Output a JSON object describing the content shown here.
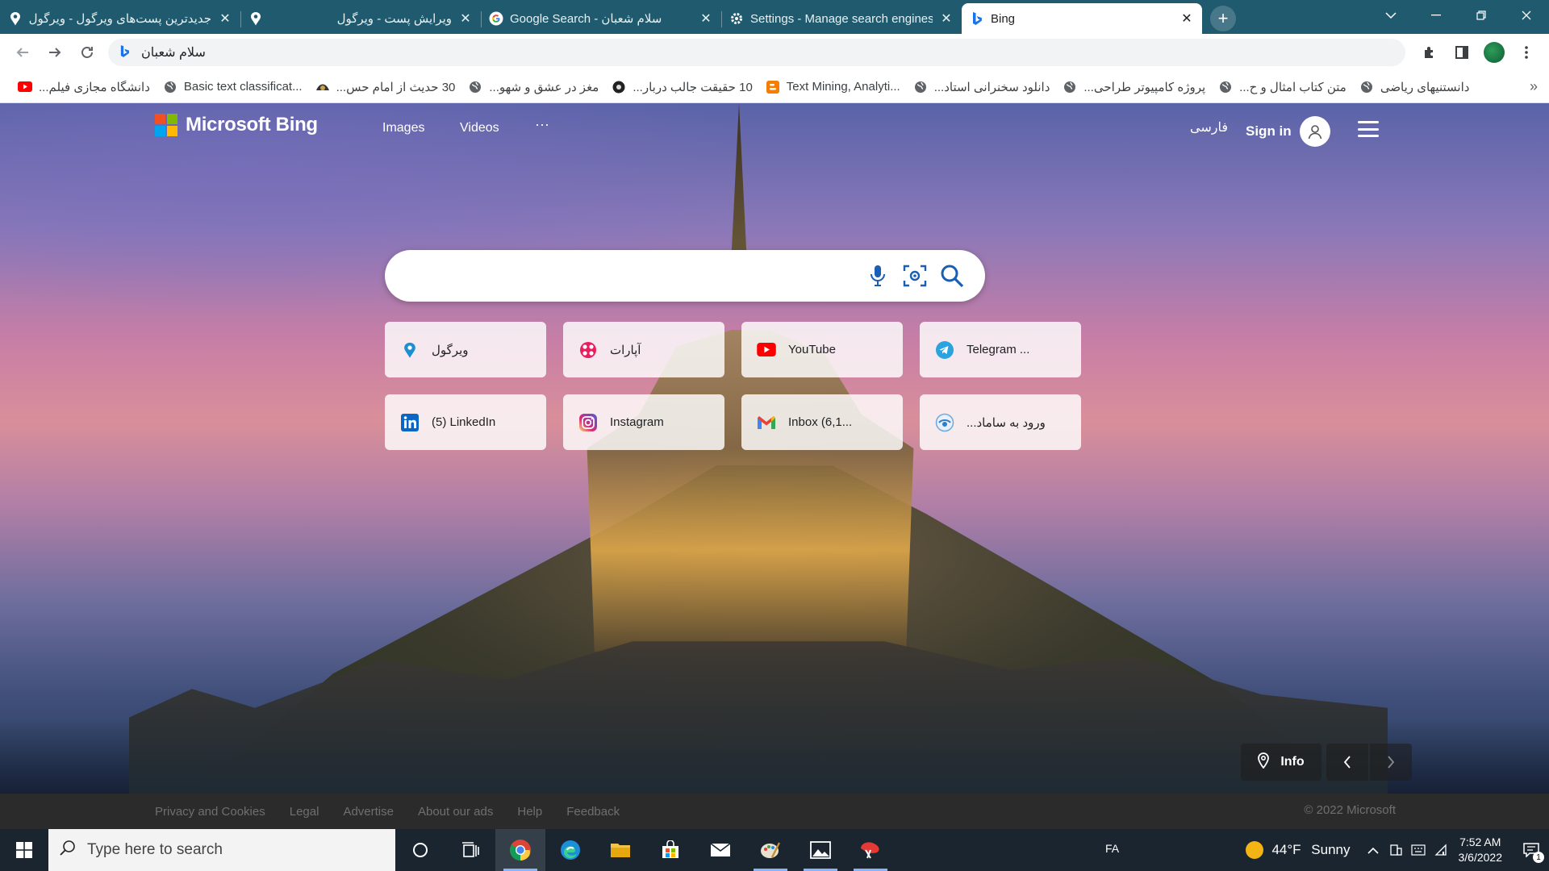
{
  "browser": {
    "tabs": [
      {
        "title": "جدیدترین پست‌های ویرگول - ویرگول",
        "icon": "virgool-icon",
        "rtl": true
      },
      {
        "title": "ویرایش پست - ویرگول",
        "icon": "virgool-icon",
        "rtl": true
      },
      {
        "title": "Google Search - سلام شعبان",
        "icon": "google-icon",
        "rtl": false
      },
      {
        "title": "Settings - Manage search engines",
        "icon": "settings-icon",
        "rtl": false
      },
      {
        "title": "Bing",
        "icon": "bing-icon",
        "rtl": false,
        "active": true
      }
    ],
    "address_bar": {
      "value": "سلام شعبان"
    },
    "bookmarks": [
      {
        "label": "دانشگاه مجازی فیلم...",
        "icon": "youtube-icon",
        "rtl": true
      },
      {
        "label": "Basic text classificat...",
        "icon": "globe-icon",
        "rtl": false
      },
      {
        "label": "30 حدیث از امام حس...",
        "icon": "site-icon",
        "rtl": true
      },
      {
        "label": "مغز در عشق و شهو...",
        "icon": "globe-icon",
        "rtl": true
      },
      {
        "label": "10 حقیقت جالب دربار...",
        "icon": "site-icon",
        "rtl": true
      },
      {
        "label": "Text Mining, Analyti...",
        "icon": "blogger-icon",
        "rtl": false
      },
      {
        "label": "دانلود سخنرانی استاد...",
        "icon": "globe-icon",
        "rtl": true
      },
      {
        "label": "پروژه کامپیوتر طراحی...",
        "icon": "globe-icon",
        "rtl": true
      },
      {
        "label": "متن کتاب امثال و ح...",
        "icon": "globe-icon",
        "rtl": true
      },
      {
        "label": "دانستنیهای ریاضی",
        "icon": "globe-icon",
        "rtl": true
      }
    ],
    "bookmarks_more": "»"
  },
  "bing": {
    "logo_text": "Microsoft Bing",
    "nav": [
      {
        "label": "Images"
      },
      {
        "label": "Videos"
      },
      {
        "label": "···"
      }
    ],
    "language_link": "فارسی",
    "sign_in": "Sign in",
    "search": {
      "value": "",
      "placeholder": ""
    },
    "quick_links": [
      {
        "label": "ویرگول",
        "icon": "virgool-icon",
        "rtl": true
      },
      {
        "label": "آپارات",
        "icon": "aparat-icon",
        "rtl": true
      },
      {
        "label": "YouTube",
        "icon": "youtube-icon",
        "rtl": false
      },
      {
        "label": "Telegram ...",
        "icon": "telegram-icon",
        "rtl": false
      },
      {
        "label": "(5) LinkedIn",
        "icon": "linkedin-icon",
        "rtl": false
      },
      {
        "label": "Instagram",
        "icon": "instagram-icon",
        "rtl": false
      },
      {
        "label": "Inbox (6,1...",
        "icon": "gmail-icon",
        "rtl": false
      },
      {
        "label": "ورود به ساماد...",
        "icon": "samad-icon",
        "rtl": true
      }
    ],
    "info_button": "Info",
    "footer": {
      "links": [
        {
          "label": "Privacy and Cookies"
        },
        {
          "label": "Legal"
        },
        {
          "label": "Advertise"
        },
        {
          "label": "About our ads"
        },
        {
          "label": "Help"
        },
        {
          "label": "Feedback"
        }
      ],
      "copyright": "© 2022 Microsoft"
    }
  },
  "taskbar": {
    "search_placeholder": "Type here to search",
    "apps": [
      {
        "icon": "cortana-icon"
      },
      {
        "icon": "task-view-icon"
      },
      {
        "icon": "chrome-icon",
        "running": true,
        "active": true
      },
      {
        "icon": "edge-icon"
      },
      {
        "icon": "file-explorer-icon"
      },
      {
        "icon": "store-icon"
      },
      {
        "icon": "mail-icon"
      },
      {
        "icon": "paint-icon",
        "running": true
      },
      {
        "icon": "photos-icon",
        "running": true
      },
      {
        "icon": "snip-icon",
        "running": true
      }
    ],
    "language": "FA",
    "weather": {
      "temp": "44°F",
      "condition": "Sunny"
    },
    "clock": {
      "time": "7:52 AM",
      "date": "3/6/2022"
    },
    "notifications_count": "1"
  },
  "colors": {
    "tabstrip": "#1f5a6e",
    "taskbar": "#1a2530",
    "footer": "#2b2b2b",
    "ms_red": "#f25022",
    "ms_green": "#7fba00",
    "ms_blue": "#00a4ef",
    "ms_yellow": "#ffb900"
  }
}
